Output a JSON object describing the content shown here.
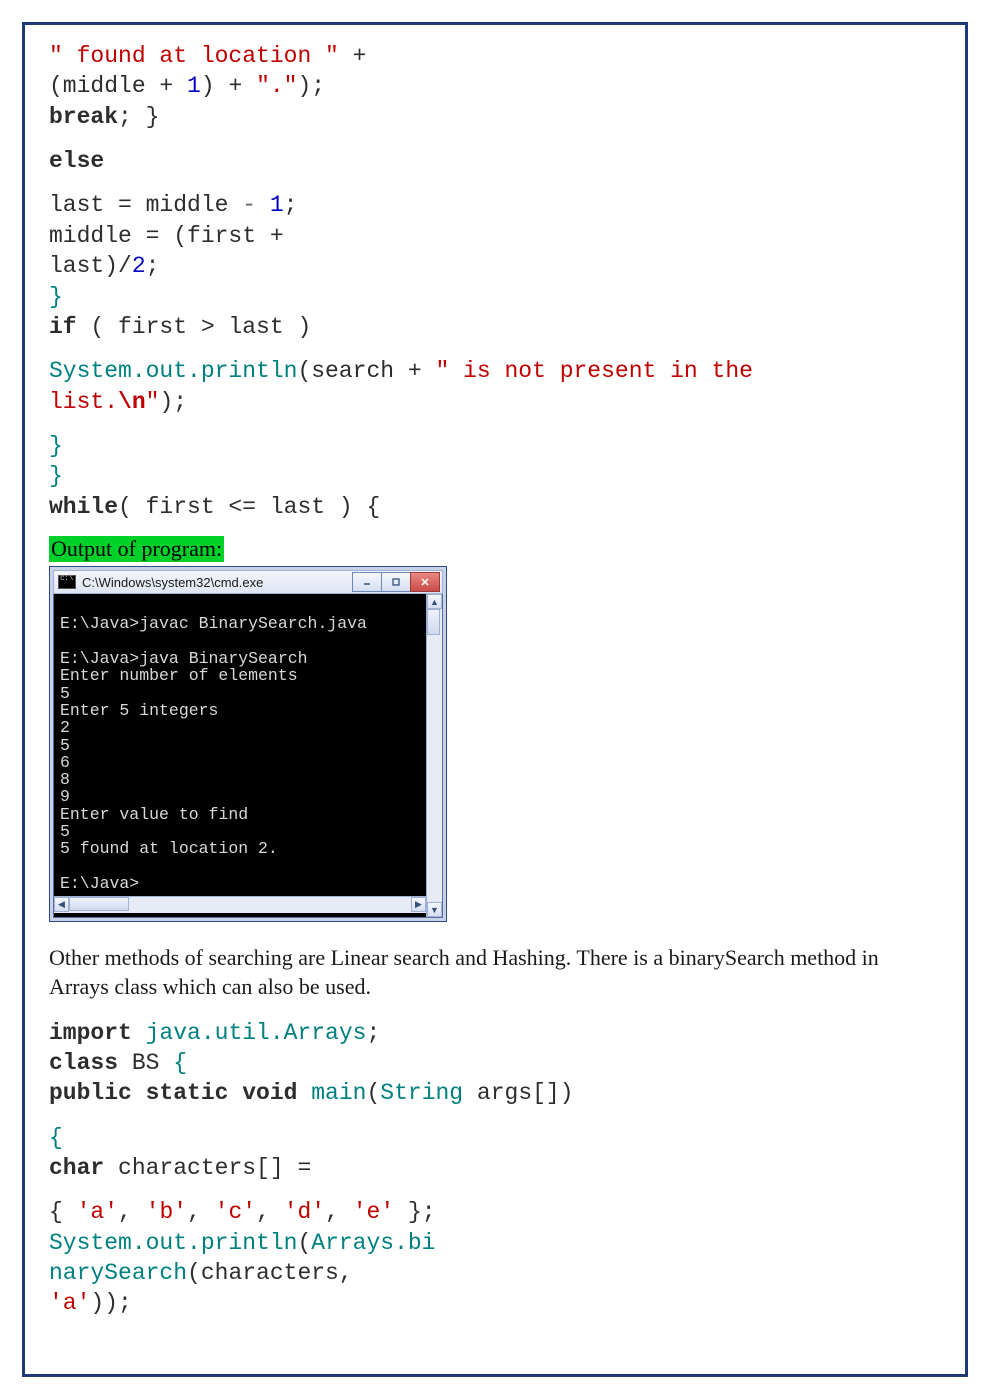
{
  "code1": {
    "l1a": "\" found at location \"",
    "l1b": " + ",
    "l2a": "(middle + ",
    "l2b": "1",
    "l2c": ") + ",
    "l2d": "\".\"",
    "l2e": ");",
    "l3a": "break",
    "l3b": "; }",
    "else": "else",
    "l4a": "last = middle ",
    "l4b": "- ",
    "l4c": "1",
    "l4d": ";",
    "l5a": "middle = (first + ",
    "l6a": "last)/",
    "l6b": "2",
    "l6c": ";",
    "brace1": "}",
    "l7a": "if",
    "l7b": " ( first > last )",
    "l8a": "System.out.println",
    "l8b": "(search + ",
    "l8c": "\" is not present in the ",
    "l9a": "list.",
    "l9b": "\\n",
    "l9c": "\"",
    "l9d": ");",
    "brace2": "}",
    "brace3": "}",
    "l10a": "while",
    "l10b": "( first <= last ) {"
  },
  "output_label": "Output of program:",
  "console": {
    "title": "C:\\Windows\\system32\\cmd.exe",
    "text": "\nE:\\Java>javac BinarySearch.java\n\nE:\\Java>java BinarySearch\nEnter number of elements\n5\nEnter 5 integers\n2\n5\n6\n8\n9\nEnter value to find\n5\n5 found at location 2.\n\nE:\\Java>"
  },
  "paragraph": "Other methods of searching are Linear search and Hashing. There is a binarySearch method in Arrays class which can also be used.",
  "code2": {
    "l1a": "import",
    "l1b": " java.util.Arrays",
    "l1c": ";",
    "l2a": "class",
    "l2b": " BS ",
    "l2c": "{",
    "l3a": "public static void",
    "l3b": " main",
    "l3c": "(",
    "l3d": "String",
    "l3e": " args[])",
    "brace_open": "{",
    "l4a": "char",
    "l4b": " characters[] = ",
    "l5a": "{ ",
    "l5b": "'a'",
    "l5c": ", ",
    "l5d": "'b'",
    "l5e": ", ",
    "l5f": "'c'",
    "l5g": ", ",
    "l5h": "'d'",
    "l5i": ", ",
    "l5j": "'e'",
    "l5k": " };",
    "l6a": "System.out.println",
    "l6b": "(",
    "l6c": "Arrays.bi",
    "l7a": "narySearch",
    "l7b": "(characters,",
    "l8a": "'a'",
    "l8b": "));"
  }
}
